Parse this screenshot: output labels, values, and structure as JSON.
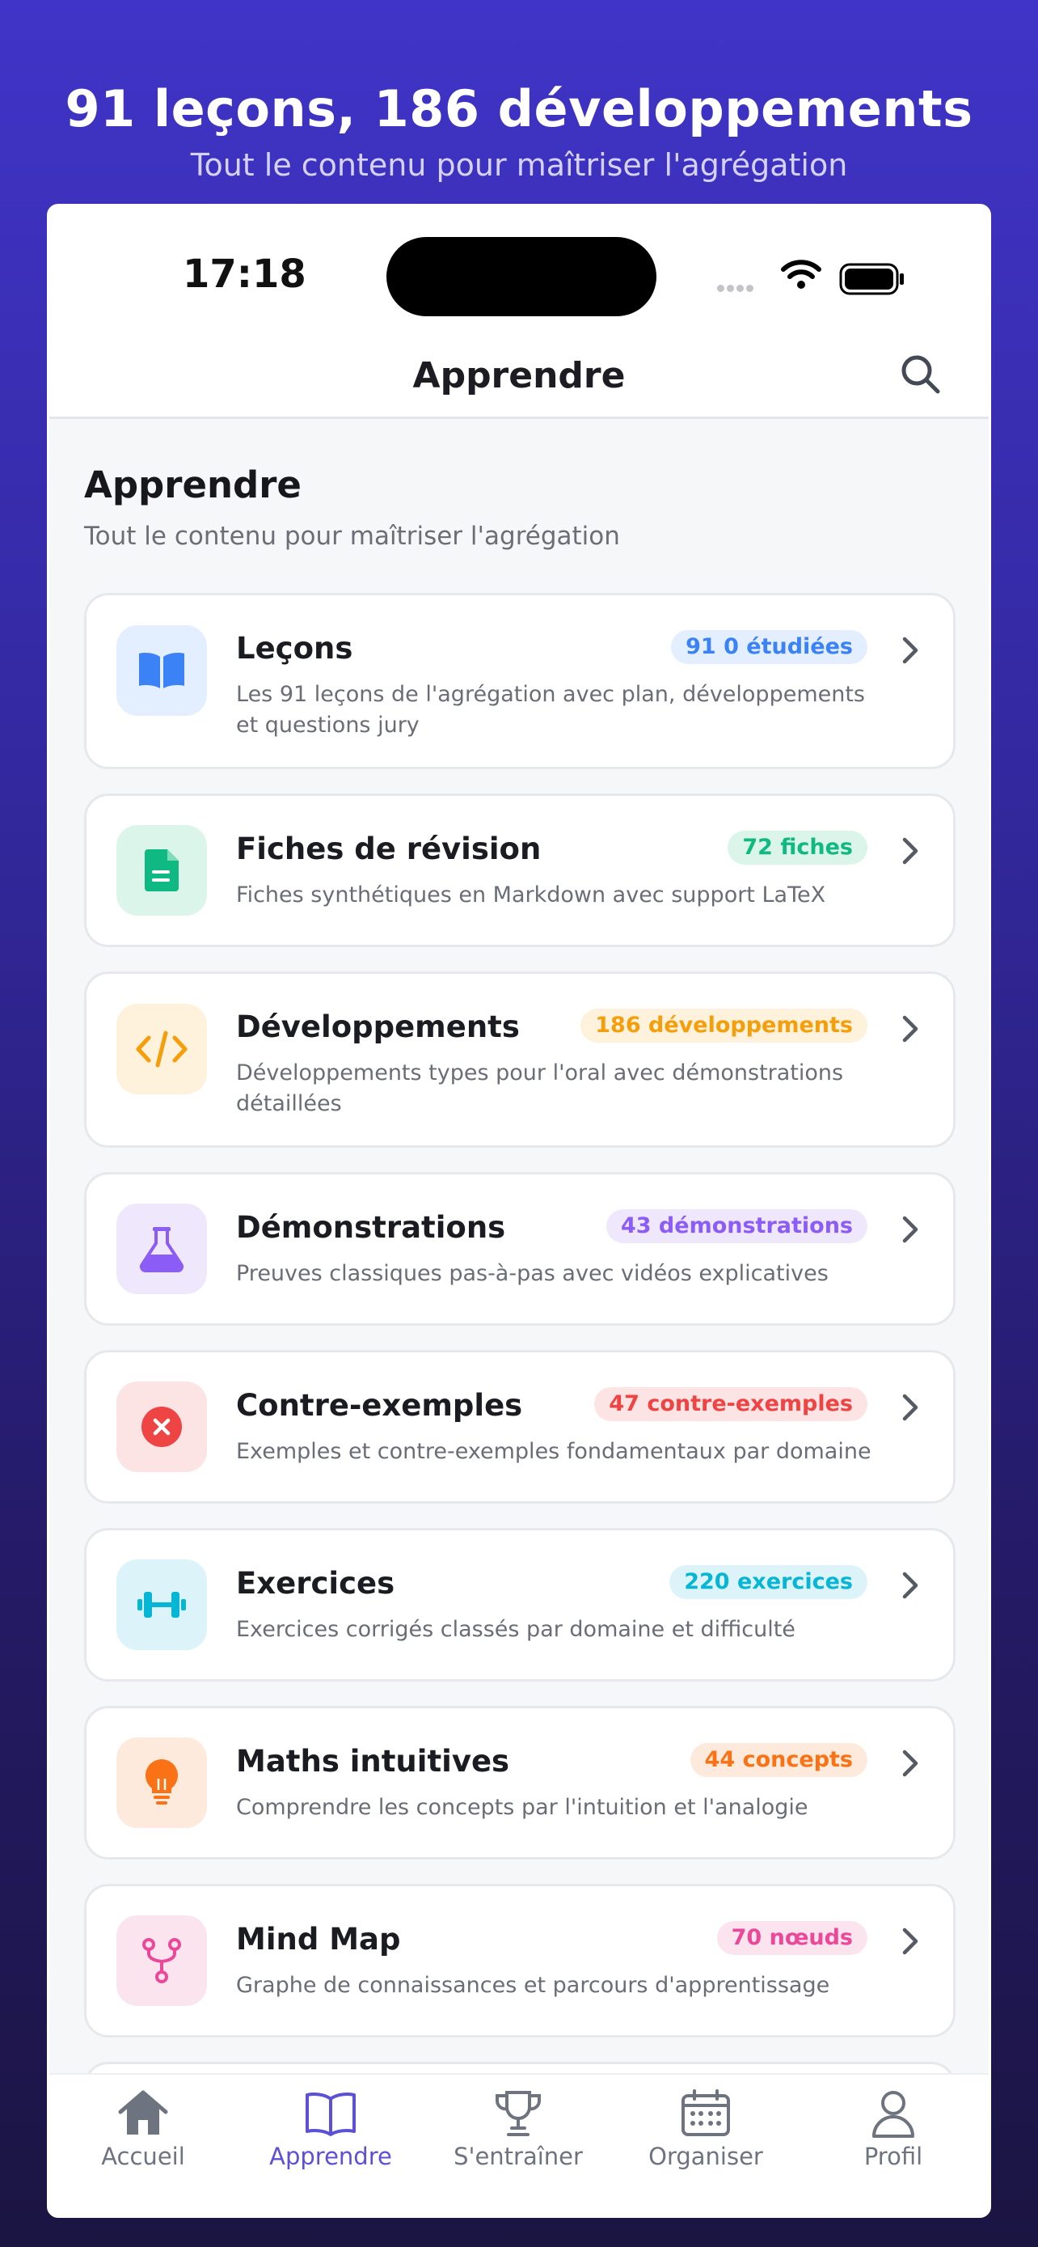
{
  "promo": {
    "title": "91 leçons, 186 développements",
    "subtitle": "Tout le contenu pour maîtriser l'agrégation"
  },
  "status_bar": {
    "time": "17:18"
  },
  "nav": {
    "title": "Apprendre"
  },
  "page": {
    "title": "Apprendre",
    "subtitle": "Tout le contenu pour maîtriser l'agrégation"
  },
  "cards": [
    {
      "title": "Leçons",
      "badge": "91 0 étudiées",
      "description": "Les 91 leçons de l'agrégation avec plan, développements et questions jury",
      "icon": "book-icon",
      "accent": "#3b82f6",
      "icon_bg": "#e3eefe",
      "badge_bg": "#e3eefe"
    },
    {
      "title": "Fiches de révision",
      "badge": "72 fiches",
      "description": "Fiches synthétiques en Markdown avec support LaTeX",
      "icon": "document-icon",
      "accent": "#10b981",
      "icon_bg": "#dcf5ea",
      "badge_bg": "#dcf5ea"
    },
    {
      "title": "Développements",
      "badge": "186 développements",
      "description": "Développements types pour l'oral avec démonstrations détaillées",
      "icon": "code-icon",
      "accent": "#f59e0b",
      "icon_bg": "#fef2dc",
      "badge_bg": "#fef2dc"
    },
    {
      "title": "Démonstrations",
      "badge": "43 démonstrations",
      "description": "Preuves classiques pas-à-pas avec vidéos explicatives",
      "icon": "flask-icon",
      "accent": "#8b5cf6",
      "icon_bg": "#efe8fd",
      "badge_bg": "#efe8fd"
    },
    {
      "title": "Contre-exemples",
      "badge": "47 contre-exemples",
      "description": "Exemples et contre-exemples fondamentaux par domaine",
      "icon": "x-circle-icon",
      "accent": "#ef4444",
      "icon_bg": "#fde4e4",
      "badge_bg": "#fde4e4"
    },
    {
      "title": "Exercices",
      "badge": "220 exercices",
      "description": "Exercices corrigés classés par domaine et difficulté",
      "icon": "dumbbell-icon",
      "accent": "#06b6d4",
      "icon_bg": "#dcf4f9",
      "badge_bg": "#dcf4f9"
    },
    {
      "title": "Maths intuitives",
      "badge": "44 concepts",
      "description": "Comprendre les concepts par l'intuition et l'analogie",
      "icon": "lightbulb-icon",
      "accent": "#f97316",
      "icon_bg": "#feeadc",
      "badge_bg": "#feeadc"
    },
    {
      "title": "Mind Map",
      "badge": "70 nœuds",
      "description": "Graphe de connaissances et parcours d'apprentissage",
      "icon": "fork-icon",
      "accent": "#ec4899",
      "icon_bg": "#fce4ef",
      "badge_bg": "#fce4ef"
    }
  ],
  "tabbar": {
    "active_color": "#5b50d6",
    "inactive_color": "#6e7380",
    "items": [
      {
        "label": "Accueil",
        "icon": "home-icon"
      },
      {
        "label": "Apprendre",
        "icon": "open-book-icon"
      },
      {
        "label": "S'entraîner",
        "icon": "trophy-icon"
      },
      {
        "label": "Organiser",
        "icon": "calendar-icon"
      },
      {
        "label": "Profil",
        "icon": "user-icon"
      }
    ]
  }
}
